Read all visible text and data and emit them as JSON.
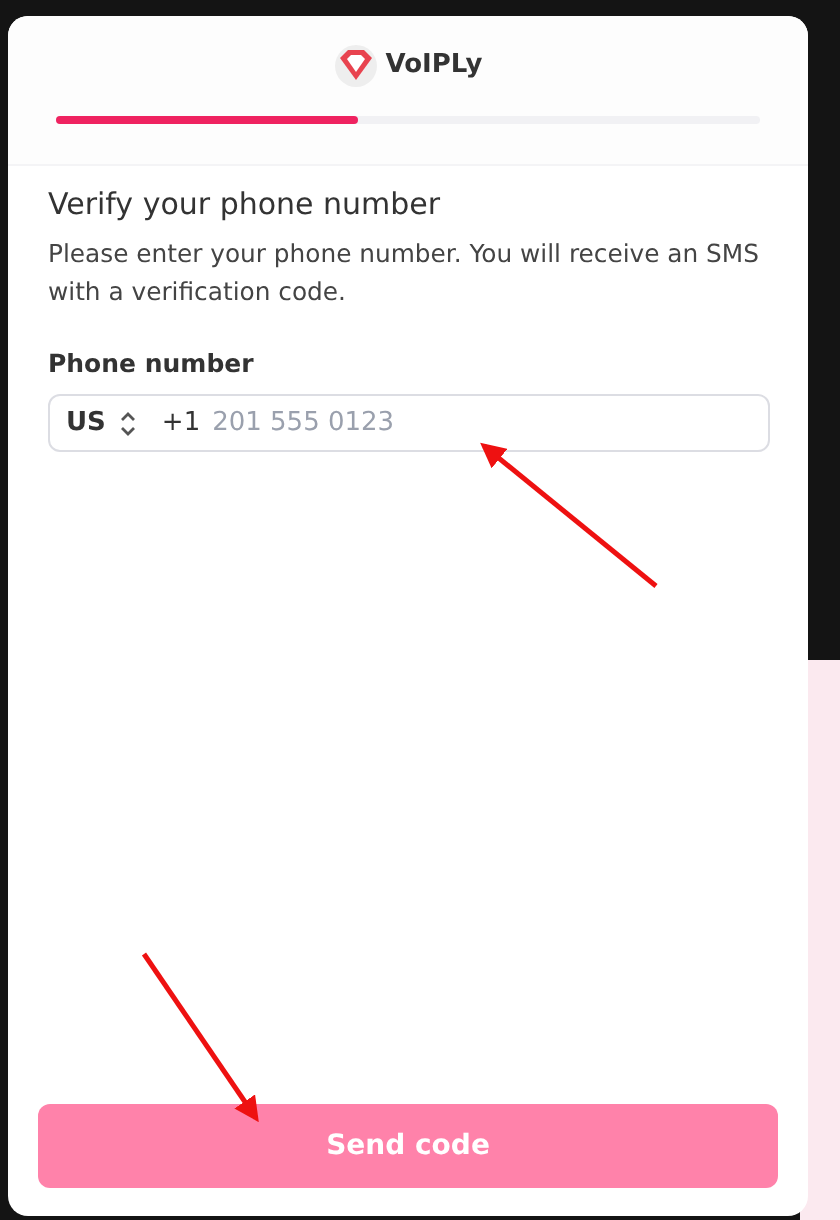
{
  "brand": "VoIPLy",
  "progress": {
    "level": 0.43
  },
  "title": "Verify your phone number",
  "description": "Please enter your phone number. You will receive an SMS with a verification code.",
  "phone": {
    "label": "Phone number",
    "country": "US",
    "dial_code": "+1",
    "placeholder": "201 555 0123"
  },
  "submit": {
    "label": "Send code",
    "disabled": true
  }
}
